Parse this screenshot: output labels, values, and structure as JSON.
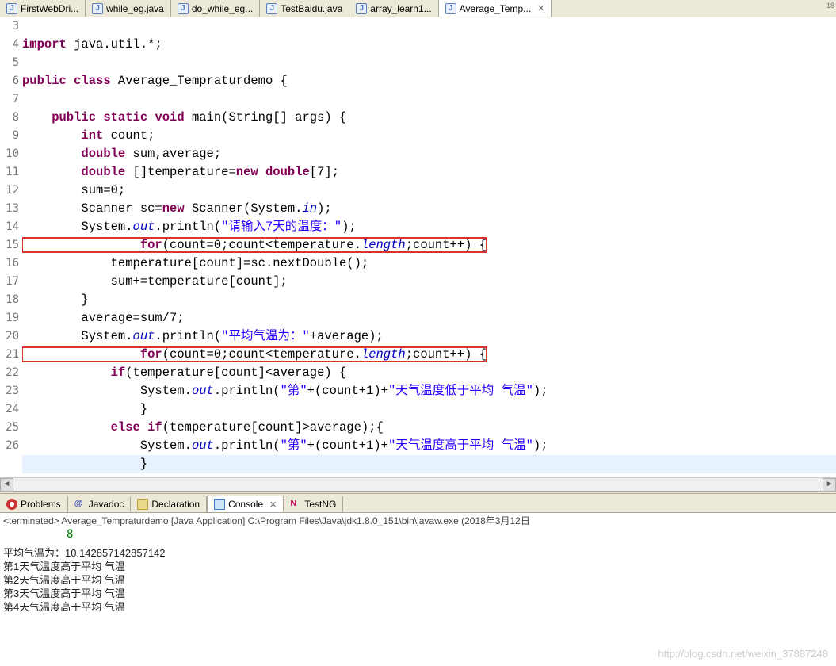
{
  "tabs": [
    {
      "label": "FirstWebDri...",
      "active": false,
      "close": false
    },
    {
      "label": "while_eg.java",
      "active": false,
      "close": false
    },
    {
      "label": "do_while_eg...",
      "active": false,
      "close": false
    },
    {
      "label": "TestBaidu.java",
      "active": false,
      "close": false
    },
    {
      "label": "array_learn1...",
      "active": false,
      "close": false
    },
    {
      "label": "Average_Temp...",
      "active": true,
      "close": true
    }
  ],
  "badge": "18",
  "gutter": [
    "3",
    "4",
    "5",
    "6",
    "7",
    "8",
    "9",
    "10",
    "11",
    "12",
    "13",
    "14",
    "15",
    "16",
    "17",
    "18",
    "19",
    "20",
    "21",
    "22",
    "23",
    "24",
    "25",
    "26"
  ],
  "views": [
    {
      "label": "Problems",
      "icon": "problems-icon",
      "color": "#c00"
    },
    {
      "label": "Javadoc",
      "icon": "javadoc-icon",
      "color": "#3f51b5"
    },
    {
      "label": "Declaration",
      "icon": "declaration-icon",
      "color": "#8a6d3b"
    },
    {
      "label": "Console",
      "icon": "console-icon",
      "color": "#3b7dc2",
      "active": true,
      "close": true
    },
    {
      "label": "TestNG",
      "icon": "testng-icon",
      "color": "#c05"
    }
  ],
  "console": {
    "terminated": "<terminated> Average_Tempraturdemo [Java Application] C:\\Program Files\\Java\\jdk1.8.0_151\\bin\\javaw.exe (2018年3月12日",
    "input": "8",
    "avg_line": "平均气温为：10.142857142857142",
    "lines": [
      "第1天气温度高于平均 气温",
      "第2天气温度高于平均 气温",
      "第3天气温度高于平均 气温",
      "第4天气温度高于平均 气温"
    ]
  },
  "code": {
    "l3a": "import",
    "l3b": " java.util.*;",
    "l5a": "public",
    "l5b": " class",
    "l5c": " Average_Tempraturdemo {",
    "l7a": "    public",
    "l7b": " static",
    "l7c": " void",
    "l7d": " main(String[] args) {",
    "l8a": "        int",
    "l8b": " count;",
    "l9a": "        double",
    "l9b": " sum,average;",
    "l10a": "        double",
    "l10b": " []temperature=",
    "l10c": "new",
    "l10d": " double",
    "l10e": "[7];",
    "l11": "        sum=0;",
    "l12a": "        Scanner sc=",
    "l12b": "new",
    "l12c": " Scanner(System.",
    "l12d": "in",
    "l12e": ");",
    "l13a": "        System.",
    "l13b": "out",
    "l13c": ".println(",
    "l13d": "\"请输入7天的温度：\"",
    "l13e": ");",
    "l14a": "        for",
    "l14b": "(count=0;count<temperature.",
    "l14c": "length",
    "l14d": ";count++) {",
    "l15": "            temperature[count]=sc.nextDouble();",
    "l16": "            sum+=temperature[count];",
    "l17": "        }",
    "l18": "        average=sum/7;",
    "l19a": "        System.",
    "l19b": "out",
    "l19c": ".println(",
    "l19d": "\"平均气温为：\"",
    "l19e": "+average);",
    "l20a": "        for",
    "l20b": "(count=0;count<temperature.",
    "l20c": "length",
    "l20d": ";count++) {",
    "l21a": "            if",
    "l21b": "(temperature[count]<average) {",
    "l22a": "                System.",
    "l22b": "out",
    "l22c": ".println(",
    "l22d": "\"第\"",
    "l22e": "+(count+1)+",
    "l22f": "\"天气温度低于平均 气温\"",
    "l22g": ");",
    "l23": "                }",
    "l24a": "            else",
    "l24b": " if",
    "l24c": "(temperature[count]>average);{",
    "l25a": "                System.",
    "l25b": "out",
    "l25c": ".println(",
    "l25d": "\"第\"",
    "l25e": "+(count+1)+",
    "l25f": "\"天气温度高于平均 气温\"",
    "l25g": ");",
    "l26": "                }"
  },
  "watermark": "http://blog.csdn.net/weixin_37887248"
}
